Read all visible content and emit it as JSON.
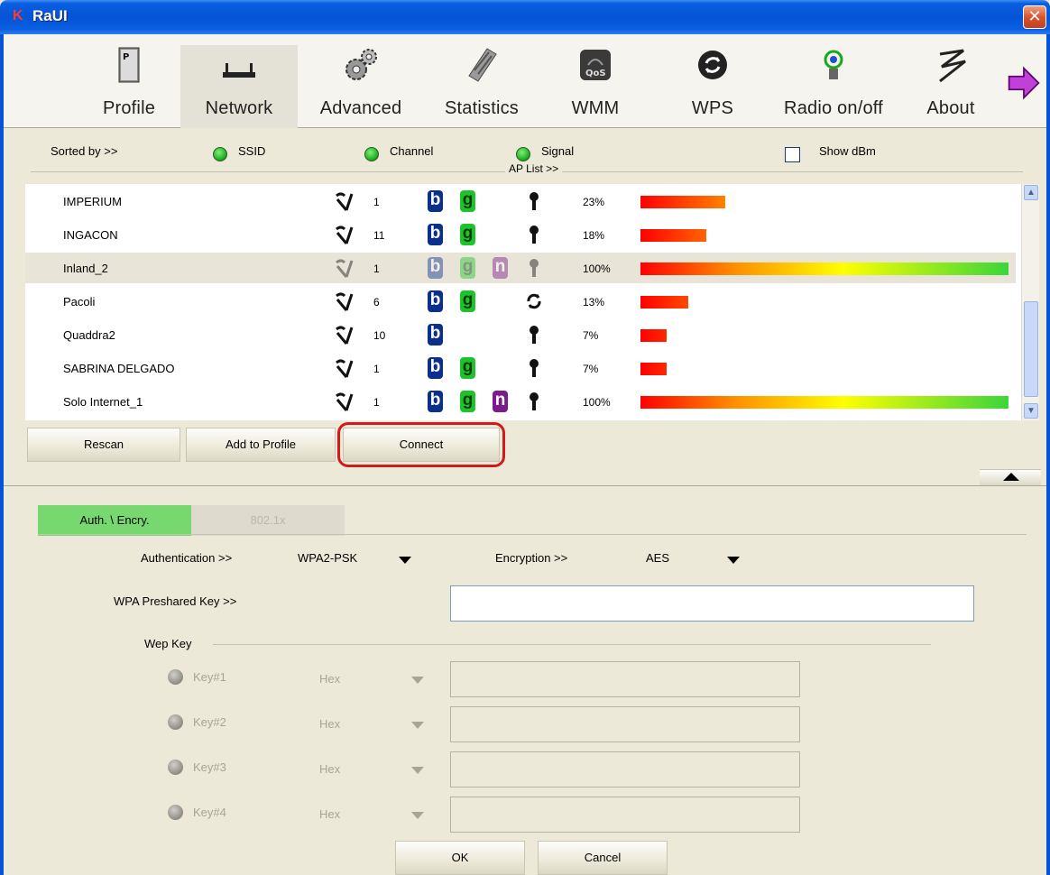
{
  "window": {
    "title": "RaUI",
    "logo": "K",
    "close_glyph": "✕"
  },
  "toolbar": [
    {
      "label": "Profile",
      "icon": "profile-icon"
    },
    {
      "label": "Network",
      "icon": "network-icon",
      "active": true
    },
    {
      "label": "Advanced",
      "icon": "gears-icon"
    },
    {
      "label": "Statistics",
      "icon": "statistics-icon"
    },
    {
      "label": "WMM",
      "icon": "wmm-qos-icon"
    },
    {
      "label": "WPS",
      "icon": "wps-icon"
    },
    {
      "label": "Radio on/off",
      "icon": "radio-antenna-icon"
    },
    {
      "label": "About",
      "icon": "about-icon"
    }
  ],
  "sortbar": {
    "sorted_by": "Sorted by >>",
    "ssid": "SSID",
    "channel": "Channel",
    "signal": "Signal",
    "show_dbm": "Show dBm",
    "ap_list_label": "AP List >>"
  },
  "ap_list": [
    {
      "ssid": "IMPERIUM",
      "channel": "1",
      "b": true,
      "g": true,
      "n": false,
      "security": "lock",
      "signal_pct": "23%",
      "signal": 23
    },
    {
      "ssid": "INGACON",
      "channel": "11",
      "b": true,
      "g": true,
      "n": false,
      "security": "lock",
      "signal_pct": "18%",
      "signal": 18
    },
    {
      "ssid": "Inland_2",
      "channel": "1",
      "b": true,
      "g": true,
      "n": true,
      "security": "lock",
      "signal_pct": "100%",
      "signal": 100,
      "selected": true
    },
    {
      "ssid": "Pacoli",
      "channel": "6",
      "b": true,
      "g": true,
      "n": false,
      "security": "wps",
      "signal_pct": "13%",
      "signal": 13
    },
    {
      "ssid": "Quaddra2",
      "channel": "10",
      "b": true,
      "g": false,
      "n": false,
      "security": "lock",
      "signal_pct": "7%",
      "signal": 7
    },
    {
      "ssid": "SABRINA DELGADO",
      "channel": "1",
      "b": true,
      "g": true,
      "n": false,
      "security": "lock",
      "signal_pct": "7%",
      "signal": 7
    },
    {
      "ssid": "Solo Internet_1",
      "channel": "1",
      "b": true,
      "g": true,
      "n": true,
      "security": "lock",
      "signal_pct": "100%",
      "signal": 100
    }
  ],
  "buttons": {
    "rescan": "Rescan",
    "add_to_profile": "Add to Profile",
    "connect": "Connect"
  },
  "tabs": {
    "auth": "Auth. \\ Encry.",
    "dot1x": "802.1x"
  },
  "form": {
    "authentication_label": "Authentication >>",
    "authentication_value": "WPA2-PSK",
    "encryption_label": "Encryption >>",
    "encryption_value": "AES",
    "psk_label": "WPA Preshared Key >>",
    "psk_value": "",
    "wep_key_label": "Wep Key",
    "wep_keys": [
      {
        "label": "Key#1",
        "format": "Hex",
        "value": ""
      },
      {
        "label": "Key#2",
        "format": "Hex",
        "value": ""
      },
      {
        "label": "Key#3",
        "format": "Hex",
        "value": ""
      },
      {
        "label": "Key#4",
        "format": "Hex",
        "value": ""
      }
    ],
    "ok": "OK",
    "cancel": "Cancel"
  },
  "colors": {
    "titlebar": "#0553d6",
    "tab_active": "#77d86f",
    "connect_highlight": "#d11a1a",
    "badge_b": "#0a2f8c",
    "badge_g": "#1cc42a",
    "badge_n": "#7a1a8c"
  }
}
